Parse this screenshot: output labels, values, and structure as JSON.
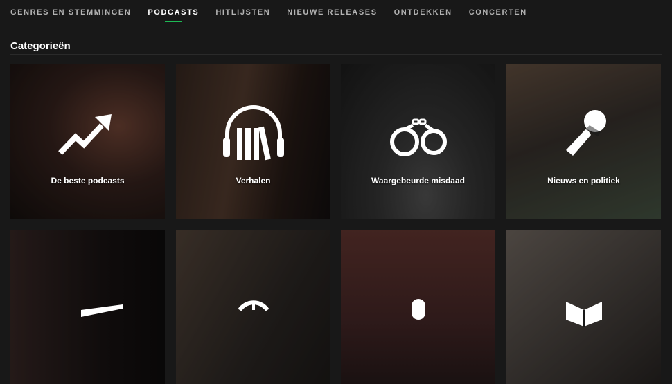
{
  "nav": {
    "tabs": [
      {
        "label": "GENRES EN STEMMINGEN",
        "active": false
      },
      {
        "label": "PODCASTS",
        "active": true
      },
      {
        "label": "HITLIJSTEN",
        "active": false
      },
      {
        "label": "NIEUWE RELEASES",
        "active": false
      },
      {
        "label": "ONTDEKKEN",
        "active": false
      },
      {
        "label": "CONCERTEN",
        "active": false
      }
    ],
    "active_indicator_color": "#1db954"
  },
  "section": {
    "title": "Categorieën"
  },
  "categories": [
    {
      "label": "De beste podcasts",
      "icon": "trending-up-icon"
    },
    {
      "label": "Verhalen",
      "icon": "headphones-books-icon"
    },
    {
      "label": "Waargebeurde misdaad",
      "icon": "handcuffs-icon"
    },
    {
      "label": "Nieuws en politiek",
      "icon": "microphone-icon"
    },
    {
      "label": "",
      "icon": "ticket-icon"
    },
    {
      "label": "",
      "icon": "basketball-icon"
    },
    {
      "label": "",
      "icon": "microphone-icon"
    },
    {
      "label": "",
      "icon": "open-book-icon"
    }
  ],
  "colors": {
    "background": "#181818",
    "text_primary": "#ffffff",
    "text_secondary": "#b3b3b3",
    "accent": "#1db954"
  }
}
